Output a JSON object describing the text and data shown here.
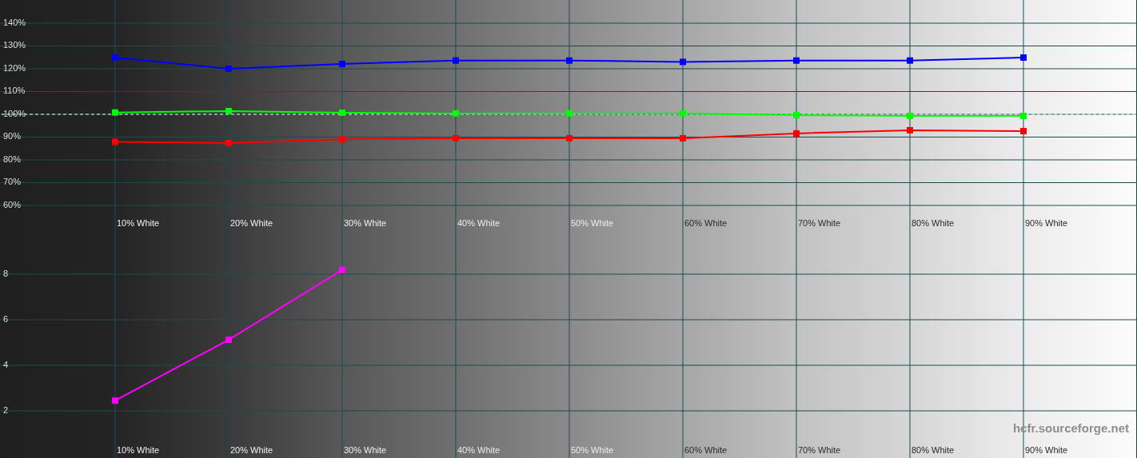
{
  "charts": [
    {
      "chart_data": {
        "type": "line",
        "categories": [
          "10% White",
          "20% White",
          "30% White",
          "40% White",
          "50% White",
          "60% White",
          "70% White",
          "80% White",
          "90% White"
        ],
        "ylim": [
          60,
          150
        ],
        "yticks": [
          {
            "value": 60,
            "label": "60%"
          },
          {
            "value": 70,
            "label": "70%"
          },
          {
            "value": 80,
            "label": "80%"
          },
          {
            "value": 90,
            "label": "90%"
          },
          {
            "value": 100,
            "label": "100%"
          },
          {
            "value": 110,
            "label": "110%"
          },
          {
            "value": 120,
            "label": "120%"
          },
          {
            "value": 130,
            "label": "130%"
          },
          {
            "value": 140,
            "label": "140%"
          }
        ],
        "series": [
          {
            "color": "#0000ff",
            "marker": "square",
            "values": [
              124.9,
              120,
              122.1,
              123.6,
              123.6,
              123,
              123.6,
              123.6,
              124.9
            ]
          },
          {
            "color": "#00ff00",
            "marker": "square",
            "values": [
              100.8,
              101.4,
              100.7,
              100.4,
              100.4,
              100.4,
              99.6,
              99.3,
              99.3
            ]
          },
          {
            "color": "#ff0000",
            "marker": "square",
            "values": [
              87.9,
              87.4,
              89,
              89.5,
              89.5,
              89.5,
              91.6,
              93,
              92.6
            ]
          }
        ],
        "grid": true,
        "ref_lines": [
          {
            "axis": "y",
            "value": 100
          }
        ]
      }
    },
    {
      "chart_data": {
        "type": "line",
        "categories": [
          "10% White",
          "20% White",
          "30% White",
          "40% White",
          "50% White",
          "60% White",
          "70% White",
          "80% White",
          "90% White"
        ],
        "ylim": [
          0,
          10
        ],
        "yticks": [
          {
            "value": 2,
            "label": "2"
          },
          {
            "value": 4,
            "label": "4"
          },
          {
            "value": 6,
            "label": "6"
          },
          {
            "value": 8,
            "label": "8"
          }
        ],
        "series": [
          {
            "color": "#ff00ff",
            "marker": "square",
            "values": [
              2.45,
              5.12,
              8.19,
              null,
              null,
              null,
              null,
              null,
              null
            ]
          }
        ],
        "grid": true
      }
    }
  ],
  "footer_label": "hcfr.sourceforge.net"
}
